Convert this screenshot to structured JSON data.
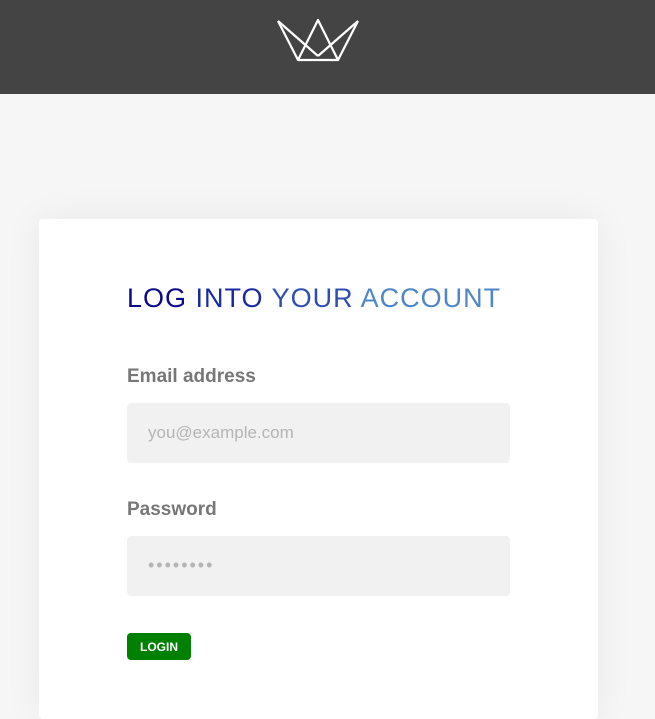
{
  "header": {
    "logo_icon": "crown-logo-icon",
    "background": "#444444"
  },
  "login": {
    "heading_parts": [
      "LOG ",
      "INTO ",
      "YOUR ",
      "ACCOUNT"
    ],
    "heading_colors": [
      "#0a0a8a",
      "#1a2aa0",
      "#2e4fb0",
      "#4f86c6"
    ],
    "email_label": "Email address",
    "email_placeholder": "you@example.com",
    "password_label": "Password",
    "password_placeholder": "••••••••",
    "login_label": "LOGIN",
    "login_color": "#008000"
  }
}
